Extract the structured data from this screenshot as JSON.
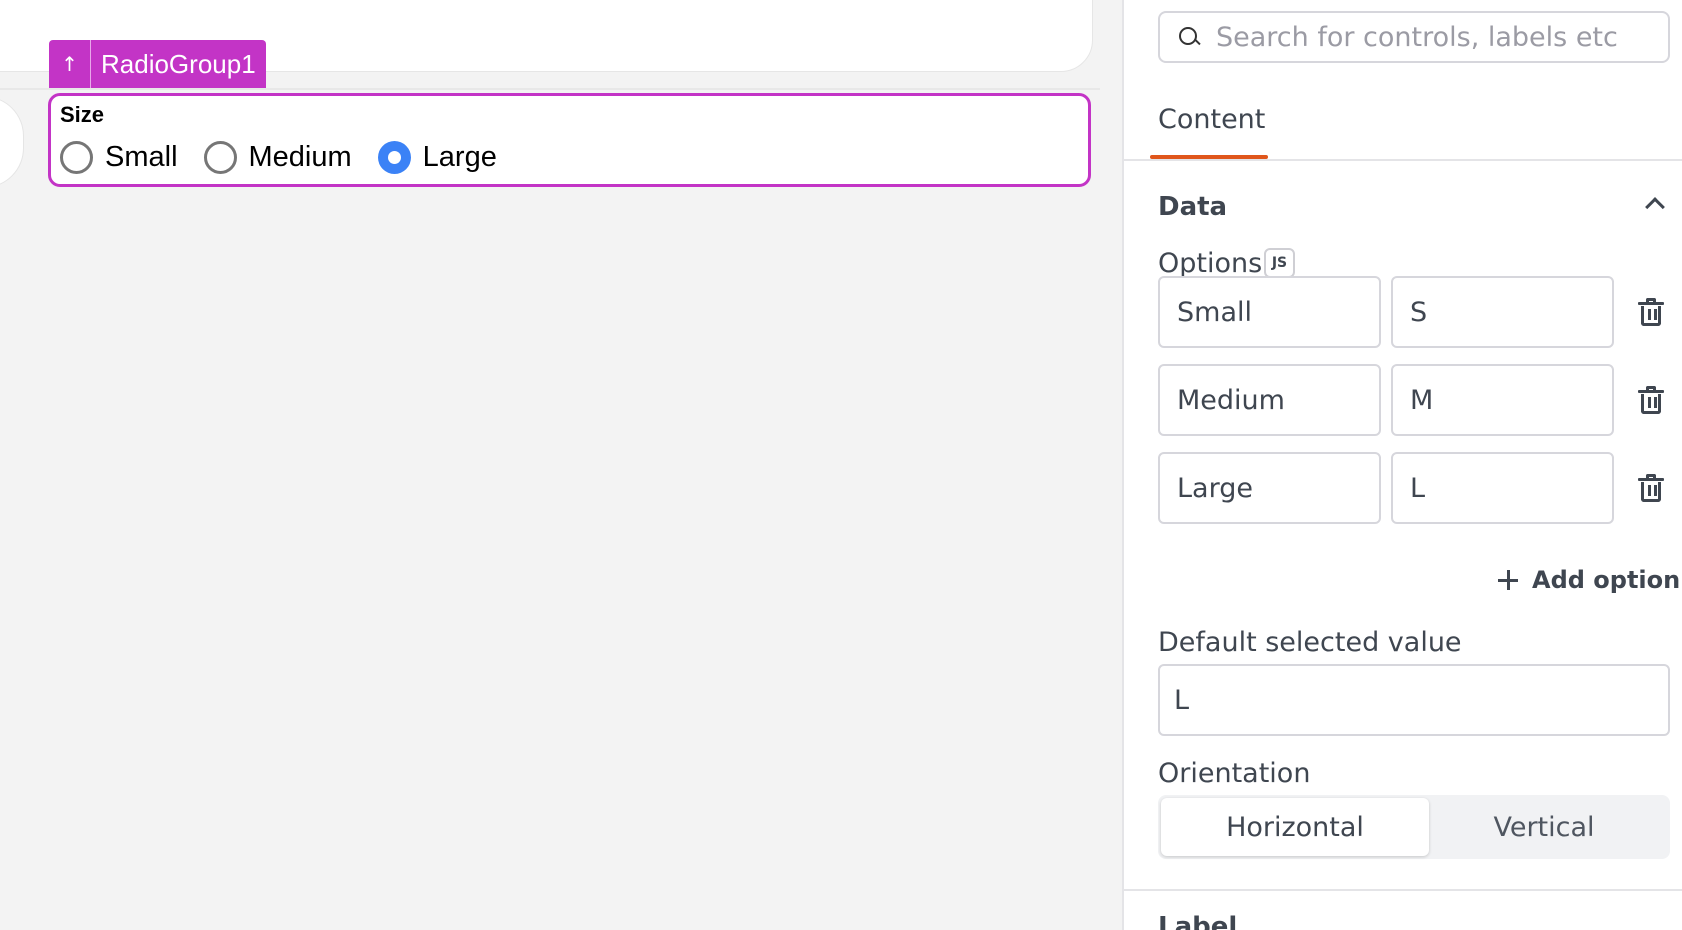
{
  "canvas": {
    "widget_tag": {
      "arrow": "↑",
      "name": "RadioGroup1"
    },
    "radio_group": {
      "label": "Size",
      "options": [
        {
          "label": "Small",
          "checked": false
        },
        {
          "label": "Medium",
          "checked": false
        },
        {
          "label": "Large",
          "checked": true
        }
      ]
    }
  },
  "panel": {
    "search": {
      "placeholder": "Search for controls, labels etc"
    },
    "tabs": [
      {
        "label": "Content",
        "active": true
      }
    ],
    "section": {
      "title": "Data",
      "expanded": true
    },
    "options_label": "Options",
    "js_badge": "JS",
    "options": [
      {
        "label": "Small",
        "value": "S"
      },
      {
        "label": "Medium",
        "value": "M"
      },
      {
        "label": "Large",
        "value": "L"
      }
    ],
    "add_option": "Add option",
    "default_value": {
      "label": "Default selected value",
      "value": "L"
    },
    "orientation": {
      "label": "Orientation",
      "options": [
        "Horizontal",
        "Vertical"
      ],
      "selected": "Horizontal"
    },
    "next_section": "Label"
  },
  "colors": {
    "accent": "#c334c6",
    "radio_checked": "#3b82f6",
    "tab_underline": "#e0561b"
  }
}
